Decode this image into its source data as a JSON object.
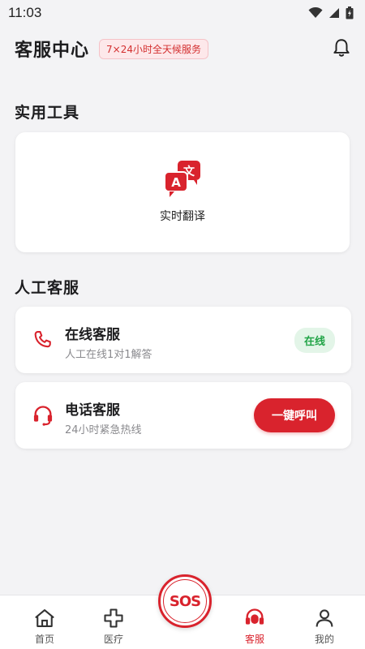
{
  "status_bar": {
    "time": "11:03",
    "icons": [
      "wifi-icon",
      "signal-icon",
      "battery-icon"
    ]
  },
  "header": {
    "title": "客服中心",
    "badge": "7×24小时全天候服务",
    "bell_icon": "bell-icon"
  },
  "tools_section": {
    "title": "实用工具",
    "items": [
      {
        "label": "实时翻译",
        "icon": "translate-icon"
      }
    ]
  },
  "service_section": {
    "title": "人工客服",
    "online": {
      "title": "在线客服",
      "subtitle": "人工在线1对1解答",
      "status": "在线",
      "icon": "phone-icon"
    },
    "phone": {
      "title": "电话客服",
      "subtitle": "24小时紧急热线",
      "action": "一键呼叫",
      "icon": "headset-icon"
    }
  },
  "sos": {
    "label": "SOS"
  },
  "bottom_nav": [
    {
      "label": "首页",
      "icon": "home-icon",
      "active": false
    },
    {
      "label": "医疗",
      "icon": "medical-cross-icon",
      "active": false
    },
    {
      "label": "客服",
      "icon": "headset-icon",
      "active": true
    },
    {
      "label": "我的",
      "icon": "user-icon",
      "active": false
    }
  ],
  "colors": {
    "accent": "#d9232d",
    "online_green": "#22a447",
    "background": "#f3f3f5"
  }
}
